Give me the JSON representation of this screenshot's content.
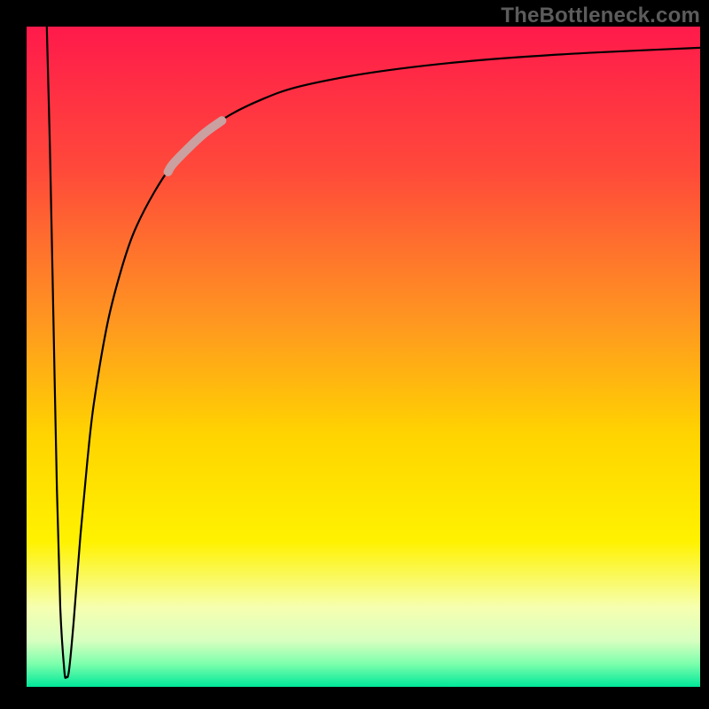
{
  "watermark": "TheBottleneck.com",
  "chart_data": {
    "type": "line",
    "title": "",
    "xlabel": "",
    "ylabel": "",
    "xlim": [
      0,
      100
    ],
    "ylim": [
      0,
      100
    ],
    "grid": false,
    "legend": false,
    "background_gradient_stops": [
      {
        "offset": 0.0,
        "color": "#ff1a4b"
      },
      {
        "offset": 0.22,
        "color": "#ff4a3a"
      },
      {
        "offset": 0.45,
        "color": "#ff9820"
      },
      {
        "offset": 0.62,
        "color": "#ffd400"
      },
      {
        "offset": 0.78,
        "color": "#fff200"
      },
      {
        "offset": 0.88,
        "color": "#f6ffb0"
      },
      {
        "offset": 0.93,
        "color": "#d8ffc0"
      },
      {
        "offset": 0.965,
        "color": "#7dffac"
      },
      {
        "offset": 1.0,
        "color": "#00e89a"
      }
    ],
    "series": [
      {
        "name": "bottleneck-curve",
        "highlight_segment": {
          "x_start": 21,
          "x_end": 29
        },
        "points": [
          {
            "x": 3.0,
            "y": 100.0
          },
          {
            "x": 3.5,
            "y": 80.0
          },
          {
            "x": 4.0,
            "y": 55.0
          },
          {
            "x": 4.5,
            "y": 30.0
          },
          {
            "x": 5.0,
            "y": 12.0
          },
          {
            "x": 5.6,
            "y": 2.5
          },
          {
            "x": 5.9,
            "y": 1.5
          },
          {
            "x": 6.3,
            "y": 2.5
          },
          {
            "x": 7.0,
            "y": 10.0
          },
          {
            "x": 8.0,
            "y": 23.0
          },
          {
            "x": 9.0,
            "y": 34.0
          },
          {
            "x": 10.0,
            "y": 43.0
          },
          {
            "x": 12.0,
            "y": 55.0
          },
          {
            "x": 14.0,
            "y": 63.0
          },
          {
            "x": 16.0,
            "y": 69.0
          },
          {
            "x": 19.0,
            "y": 75.0
          },
          {
            "x": 22.0,
            "y": 79.5
          },
          {
            "x": 26.0,
            "y": 83.5
          },
          {
            "x": 30.0,
            "y": 86.5
          },
          {
            "x": 35.0,
            "y": 89.0
          },
          {
            "x": 40.0,
            "y": 90.8
          },
          {
            "x": 48.0,
            "y": 92.5
          },
          {
            "x": 56.0,
            "y": 93.7
          },
          {
            "x": 65.0,
            "y": 94.7
          },
          {
            "x": 75.0,
            "y": 95.5
          },
          {
            "x": 85.0,
            "y": 96.1
          },
          {
            "x": 100.0,
            "y": 96.8
          }
        ]
      }
    ]
  }
}
